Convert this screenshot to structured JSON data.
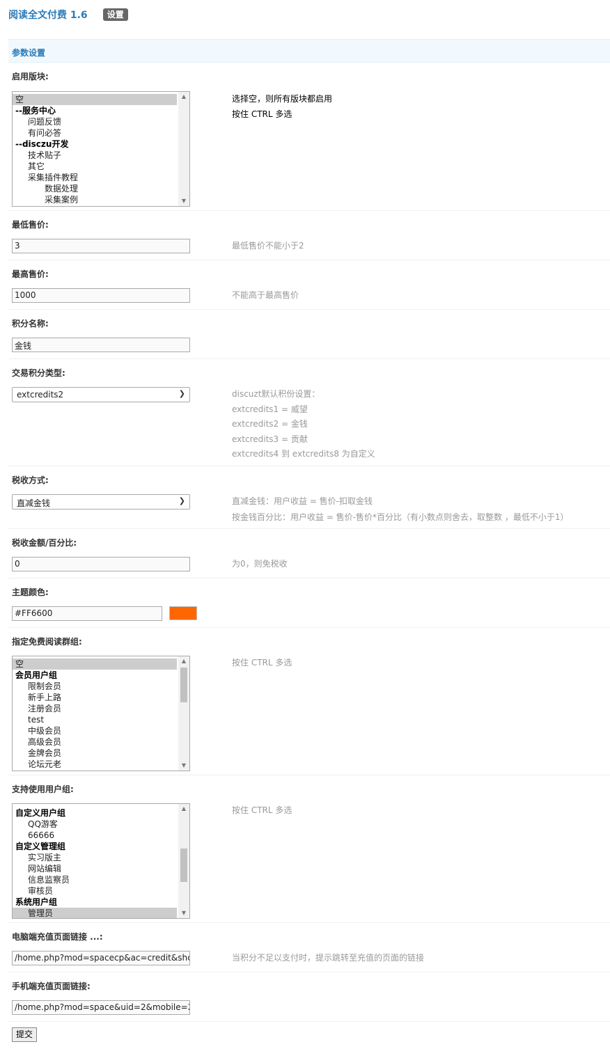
{
  "app": {
    "title": "阅读全文付费 1.6",
    "tab_label": "设置"
  },
  "section": {
    "title": "参数设置"
  },
  "fields": {
    "forums": {
      "label": "启用版块:",
      "options": [
        {
          "text": "空",
          "selected": true,
          "level": 0,
          "group": false
        },
        {
          "text": "--服务中心",
          "selected": false,
          "level": 0,
          "group": true
        },
        {
          "text": "问题反馈",
          "selected": false,
          "level": 1,
          "group": false
        },
        {
          "text": "有问必答",
          "selected": false,
          "level": 1,
          "group": false
        },
        {
          "text": "--disczu开发",
          "selected": false,
          "level": 0,
          "group": true
        },
        {
          "text": "技术贴子",
          "selected": false,
          "level": 1,
          "group": false
        },
        {
          "text": "其它",
          "selected": false,
          "level": 1,
          "group": false
        },
        {
          "text": "采集插件教程",
          "selected": false,
          "level": 1,
          "group": false
        },
        {
          "text": "数据处理",
          "selected": false,
          "level": 2,
          "group": false
        },
        {
          "text": "采集案例",
          "selected": false,
          "level": 2,
          "group": false
        }
      ],
      "hint1": "选择空，则所有版块都启用",
      "hint2": "按住 CTRL 多选"
    },
    "min_price": {
      "label": "最低售价:",
      "value": "3",
      "hint": "最低售价不能小于2"
    },
    "max_price": {
      "label": "最高售价:",
      "value": "1000",
      "hint": "不能高于最高售价"
    },
    "credit_name": {
      "label": "积分名称:",
      "value": "金钱"
    },
    "credit_type": {
      "label": "交易积分类型:",
      "value": "extcredits2",
      "hints": [
        "discuzt默认积份设置：",
        "extcredits1 = 威望",
        "extcredits2 = 金钱",
        "extcredits3 = 贡献",
        "extcredits4 到 extcredits8 为自定义"
      ]
    },
    "tax_mode": {
      "label": "税收方式:",
      "value": "直减金钱",
      "hints": [
        "直减金钱：用户收益 = 售价-扣取金钱",
        "按金钱百分比：用户收益 = 售价-售价*百分比（有小数点则舍去，取整数 ，最低不小于1）"
      ]
    },
    "tax_amount": {
      "label": "税收金额/百分比:",
      "value": "0",
      "hint": "为0，则免税收"
    },
    "theme_color": {
      "label": "主题颜色:",
      "value": "#FF6600",
      "swatch": "#ff6600"
    },
    "free_groups": {
      "label": "指定免费阅读群组:",
      "options": [
        {
          "text": "空",
          "selected": true,
          "level": 0,
          "group": false
        },
        {
          "text": "会员用户组",
          "selected": false,
          "level": 0,
          "group": true
        },
        {
          "text": "限制会员",
          "selected": false,
          "level": 1,
          "group": false
        },
        {
          "text": "新手上路",
          "selected": false,
          "level": 1,
          "group": false
        },
        {
          "text": "注册会员",
          "selected": false,
          "level": 1,
          "group": false
        },
        {
          "text": "test",
          "selected": false,
          "level": 1,
          "group": false
        },
        {
          "text": "中级会员",
          "selected": false,
          "level": 1,
          "group": false
        },
        {
          "text": "高级会员",
          "selected": false,
          "level": 1,
          "group": false
        },
        {
          "text": "金牌会员",
          "selected": false,
          "level": 1,
          "group": false
        },
        {
          "text": "论坛元老",
          "selected": false,
          "level": 1,
          "group": false
        }
      ],
      "hint": "按住 CTRL 多选"
    },
    "allowed_groups": {
      "label": "支持使用用户组:",
      "options": [
        {
          "text": "自定义用户组",
          "selected": false,
          "level": 0,
          "group": true
        },
        {
          "text": "QQ游客",
          "selected": false,
          "level": 1,
          "group": false
        },
        {
          "text": "66666",
          "selected": false,
          "level": 1,
          "group": false
        },
        {
          "text": "自定义管理组",
          "selected": false,
          "level": 0,
          "group": true
        },
        {
          "text": "实习版主",
          "selected": false,
          "level": 1,
          "group": false
        },
        {
          "text": "网站编辑",
          "selected": false,
          "level": 1,
          "group": false
        },
        {
          "text": "信息监察员",
          "selected": false,
          "level": 1,
          "group": false
        },
        {
          "text": "审核员",
          "selected": false,
          "level": 1,
          "group": false
        },
        {
          "text": "系统用户组",
          "selected": false,
          "level": 0,
          "group": true
        },
        {
          "text": "管理员",
          "selected": true,
          "level": 1,
          "group": false
        }
      ],
      "hint": "按住 CTRL 多选"
    },
    "pc_recharge_link": {
      "label": "电脑端充值页面链接 ...:",
      "value": "/home.php?mod=spacecp&ac=credit&shc",
      "hint": "当积分不足以支付时，提示跳转至充值的页面的链接"
    },
    "mobile_recharge_link": {
      "label": "手机端充值页面链接:",
      "value": "/home.php?mod=space&uid=2&mobile=2"
    }
  },
  "submit_label": "提交"
}
